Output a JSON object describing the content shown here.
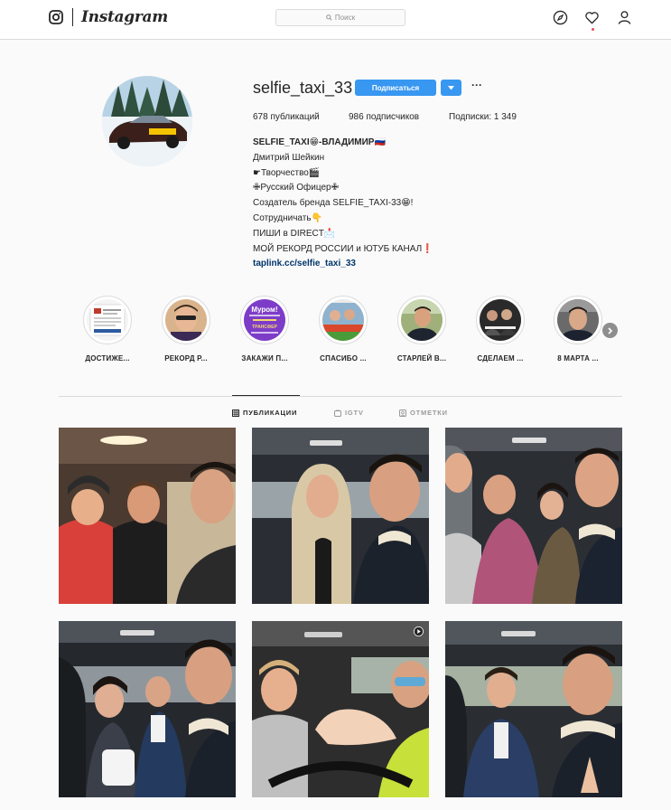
{
  "nav": {
    "brand": "Instagram",
    "search_placeholder": "Поиск"
  },
  "profile": {
    "username": "selfie_taxi_33",
    "follow_label": "Подписаться",
    "more_label": "···",
    "stats": {
      "posts": "678 публикаций",
      "followers": "986 подписчиков",
      "following": "Подписки: 1 349"
    },
    "bio": {
      "title": "SELFIE_TAXI😁-ВЛАДИМИР🇷🇺",
      "lines": [
        "Дмитрий Шейкин",
        "☛Творчество🎬",
        "✙Русский Офицер✙",
        "Создатель бренда SELFIE_TAXI-33😁!",
        "Сотрудничать👇",
        "ПИШИ в DIRECT📩",
        "МОЙ РЕКОРД РОССИИ и ЮТУБ КАНАЛ❗"
      ],
      "link": "taplink.cc/selfie_taxi_33"
    }
  },
  "highlights": [
    {
      "label": "ДОСТИЖЕ..."
    },
    {
      "label": "РЕКОРД Р..."
    },
    {
      "label": "ЗАКАЖИ П...",
      "cover_text": [
        "Муром!",
        "ТРАНСФЕР"
      ]
    },
    {
      "label": "СПАСИБО ..."
    },
    {
      "label": "СТАРЛЕЙ В..."
    },
    {
      "label": "СДЕЛАЕМ ..."
    },
    {
      "label": "8 МАРТА ..."
    }
  ],
  "tabs": [
    {
      "label": "ПУБЛИКАЦИИ",
      "active": true
    },
    {
      "label": "IGTV",
      "active": false
    },
    {
      "label": "ОТМЕТКИ",
      "active": false
    }
  ],
  "colors": {
    "accent": "#3897f0",
    "border": "#dbdbdb",
    "background": "#fafafa",
    "link": "#003569",
    "notification": "#ed4956"
  }
}
